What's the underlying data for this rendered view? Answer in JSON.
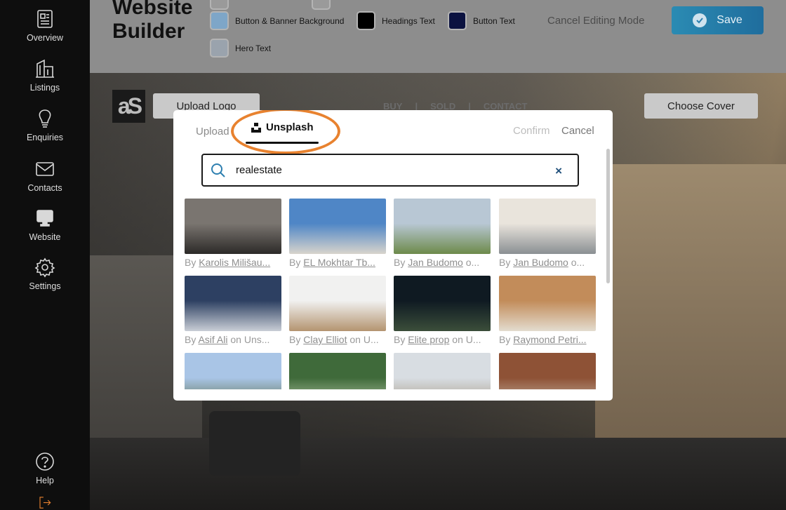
{
  "sidebar": {
    "items": [
      {
        "label": "Overview",
        "icon": "newspaper-icon"
      },
      {
        "label": "Listings",
        "icon": "building-icon"
      },
      {
        "label": "Enquiries",
        "icon": "lightbulb-icon"
      },
      {
        "label": "Contacts",
        "icon": "mail-icon"
      },
      {
        "label": "Website",
        "icon": "monitor-icon"
      },
      {
        "label": "Settings",
        "icon": "gear-icon"
      },
      {
        "label": "Help",
        "icon": "help-icon"
      }
    ]
  },
  "header": {
    "title": "Website Builder",
    "swatches": [
      {
        "label": "Button & Banner Background",
        "color": "#7ea6c8"
      },
      {
        "label": "Headings Text",
        "color": "#000000"
      },
      {
        "label": "Button Text",
        "color": "#0b1240"
      },
      {
        "label": "Hero Text",
        "color": "#9aa3ad"
      }
    ],
    "cancel_editing": "Cancel Editing Mode",
    "save_label": "Save"
  },
  "hero": {
    "logo_text": "aS",
    "upload_logo": "Upload Logo",
    "choose_cover": "Choose Cover",
    "nav": [
      "BUY",
      "SOLD",
      "CONTACT"
    ],
    "nav_separator": "|"
  },
  "modal": {
    "tab_upload": "Upload",
    "tab_unsplash": "Unsplash",
    "confirm": "Confirm",
    "cancel": "Cancel",
    "search_value": "realestate",
    "clear": "×",
    "results": [
      {
        "prefix": "By",
        "author": "Karolis Milišau...",
        "suffix": "",
        "colors": [
          "#7a7570",
          "#2c2a28"
        ]
      },
      {
        "prefix": "By",
        "author": "EL Mokhtar Tb...",
        "suffix": "",
        "colors": [
          "#4f86c6",
          "#d8d4cc"
        ]
      },
      {
        "prefix": "By",
        "author": "Jan Budomo",
        "suffix": "o...",
        "colors": [
          "#b8c7d4",
          "#6d8a4a"
        ]
      },
      {
        "prefix": "By",
        "author": "Jan Budomo",
        "suffix": "o...",
        "colors": [
          "#e9e4dc",
          "#8a8f93"
        ]
      },
      {
        "prefix": "By",
        "author": "Asif Ali",
        "suffix": "on Uns...",
        "colors": [
          "#2d4062",
          "#c9ced6"
        ]
      },
      {
        "prefix": "By",
        "author": "Clay Elliot",
        "suffix": "on U...",
        "colors": [
          "#f1f1f0",
          "#b49470"
        ]
      },
      {
        "prefix": "By",
        "author": "Elite prop",
        "suffix": "on U...",
        "colors": [
          "#0f1a22",
          "#3b4e3a"
        ]
      },
      {
        "prefix": "By",
        "author": "Raymond Petri...",
        "suffix": "",
        "colors": [
          "#c28c5a",
          "#e3dccf"
        ]
      },
      {
        "prefix": "",
        "author": "",
        "suffix": "",
        "colors": [
          "#a9c5e6",
          "#5c6e4b"
        ]
      },
      {
        "prefix": "",
        "author": "",
        "suffix": "",
        "colors": [
          "#3f6a3a",
          "#b8c9a8"
        ]
      },
      {
        "prefix": "",
        "author": "",
        "suffix": "",
        "colors": [
          "#d8dde2",
          "#a59884"
        ]
      },
      {
        "prefix": "",
        "author": "",
        "suffix": "",
        "colors": [
          "#8e5236",
          "#c7b7a6"
        ]
      }
    ]
  }
}
